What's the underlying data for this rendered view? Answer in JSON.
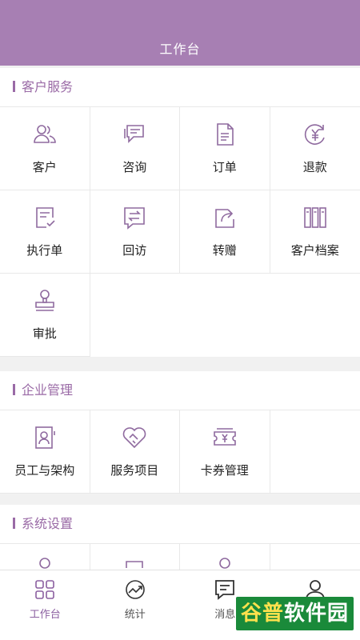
{
  "header": {
    "title": "工作台"
  },
  "sections": {
    "customer_service": {
      "title": "客户服务",
      "items": [
        "客户",
        "咨询",
        "订单",
        "退款",
        "执行单",
        "回访",
        "转赠",
        "客户档案",
        "审批"
      ]
    },
    "enterprise": {
      "title": "企业管理",
      "items": [
        "员工与架构",
        "服务项目",
        "卡券管理"
      ]
    },
    "system": {
      "title": "系统设置"
    }
  },
  "tabbar": {
    "items": [
      "工作台",
      "统计",
      "消息",
      ""
    ]
  },
  "watermark": {
    "part1": "谷普",
    "part2": "软件园"
  },
  "colors": {
    "primary": "#a77fb3",
    "accent_text": "#9a6aa6",
    "icon": "#8f6a9f"
  }
}
